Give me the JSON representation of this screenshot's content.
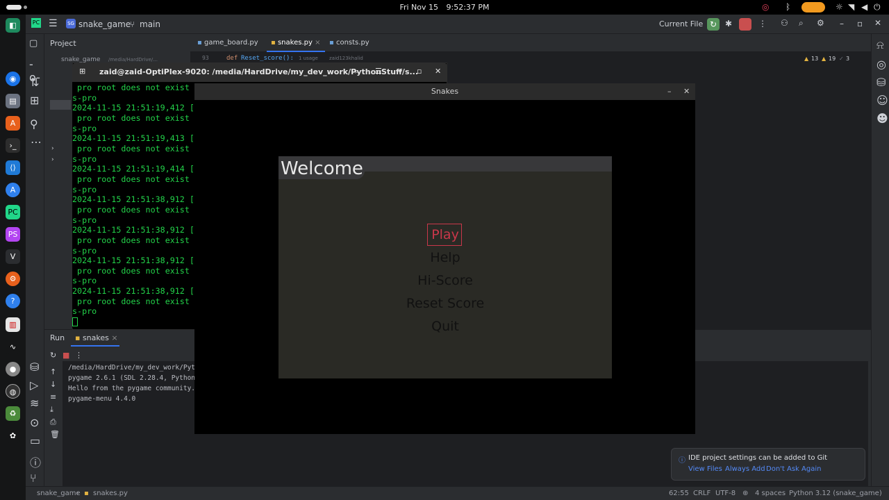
{
  "topbar": {
    "date": "Fri Nov 15",
    "time": "9:52:37 PM"
  },
  "ide": {
    "project_name": "snake_game",
    "project_badge": "SG",
    "branch": "main",
    "run_config": "Current File",
    "project_label": "Project",
    "tabs": [
      {
        "label": "game_board.py"
      },
      {
        "label": "snakes.py",
        "close": "×"
      },
      {
        "label": "consts.py"
      }
    ],
    "code_line_no": "93",
    "code_def": "def",
    "code_fn": "Reset_score():",
    "code_usage": "1 usage",
    "code_author": "zaid123khalid",
    "inspections": {
      "warnings": "13",
      "weak": "19",
      "typos": "3"
    },
    "project_root_label": "snake_game",
    "project_root_path": "/media/HardDrive/..."
  },
  "terminal": {
    "title": "zaid@zaid-OptiPlex-9020: /media/HardDrive/my_dev_work/PythonStuff/s...",
    "lines": [
      " pro root does not exist /s",
      "s-pro",
      "2024-11-15 21:51:19,412 [ (",
      " pro root does not exist /s",
      "s-pro",
      "2024-11-15 21:51:19,413 [ (",
      " pro root does not exist /s",
      "s-pro",
      "2024-11-15 21:51:19,414 [ (",
      " pro root does not exist /s",
      "s-pro",
      "2024-11-15 21:51:38,912 [ (",
      " pro root does not exist /s",
      "s-pro",
      "2024-11-15 21:51:38,912 [ (",
      " pro root does not exist /s",
      "s-pro",
      "2024-11-15 21:51:38,912 [ (",
      " pro root does not exist /s",
      "s-pro",
      "2024-11-15 21:51:38,912 [ (",
      " pro root does not exist /s",
      "s-pro"
    ]
  },
  "game": {
    "window_title": "Snakes",
    "menu_title": "Welcome",
    "items": [
      "Play",
      "Help",
      "Hi-Score",
      "Reset Score",
      "Quit"
    ],
    "selected_color": "#c9374a"
  },
  "run": {
    "label": "Run",
    "tab": "snakes",
    "output": [
      "/media/HardDrive/my_dev_work/Python",
      "pygame 2.6.1 (SDL 2.28.4, Python 3",
      "Hello from the pygame community. h",
      "pygame-menu 4.4.0"
    ]
  },
  "notification": {
    "message": "IDE project settings can be added to Git",
    "actions": [
      "View Files",
      "Always Add",
      "Don't Ask Again"
    ]
  },
  "status": {
    "crumb1": "snake_game",
    "crumb2": "snakes.py",
    "position": "62:55",
    "line_sep": "CRLF",
    "encoding": "UTF-8",
    "indent": "4 spaces",
    "interpreter": "Python 3.12 (snake_game)"
  }
}
